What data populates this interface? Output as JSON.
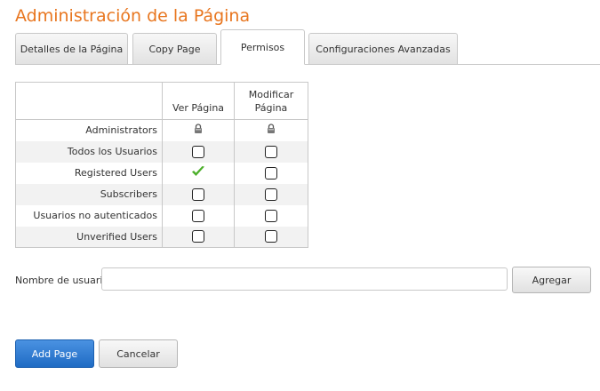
{
  "title": "Administración de la Página",
  "tabs": [
    {
      "label": "Detalles de la Página",
      "active": false
    },
    {
      "label": "Copy Page",
      "active": false
    },
    {
      "label": "Permisos",
      "active": true
    },
    {
      "label": "Configuraciones Avanzadas",
      "active": false
    }
  ],
  "permissions": {
    "columns": {
      "view": "Ver Página",
      "edit_line1": "Modificar",
      "edit_line2": "Página"
    },
    "rows": [
      {
        "role": "Administrators",
        "view": "locked",
        "edit": "locked"
      },
      {
        "role": "Todos los Usuarios",
        "view": "unchecked",
        "edit": "unchecked"
      },
      {
        "role": "Registered Users",
        "view": "checked",
        "edit": "unchecked"
      },
      {
        "role": "Subscribers",
        "view": "unchecked",
        "edit": "unchecked"
      },
      {
        "role": "Usuarios no autenticados",
        "view": "unchecked",
        "edit": "unchecked"
      },
      {
        "role": "Unverified Users",
        "view": "unchecked",
        "edit": "unchecked"
      }
    ]
  },
  "user_field": {
    "label": "Nombre de usuario:",
    "value": "",
    "placeholder": ""
  },
  "buttons": {
    "add_user": "Agregar",
    "add_page": "Add Page",
    "cancel": "Cancelar"
  },
  "colors": {
    "title": "#e8761f",
    "primary": "#2f7dd6",
    "check": "#4caf2a"
  }
}
